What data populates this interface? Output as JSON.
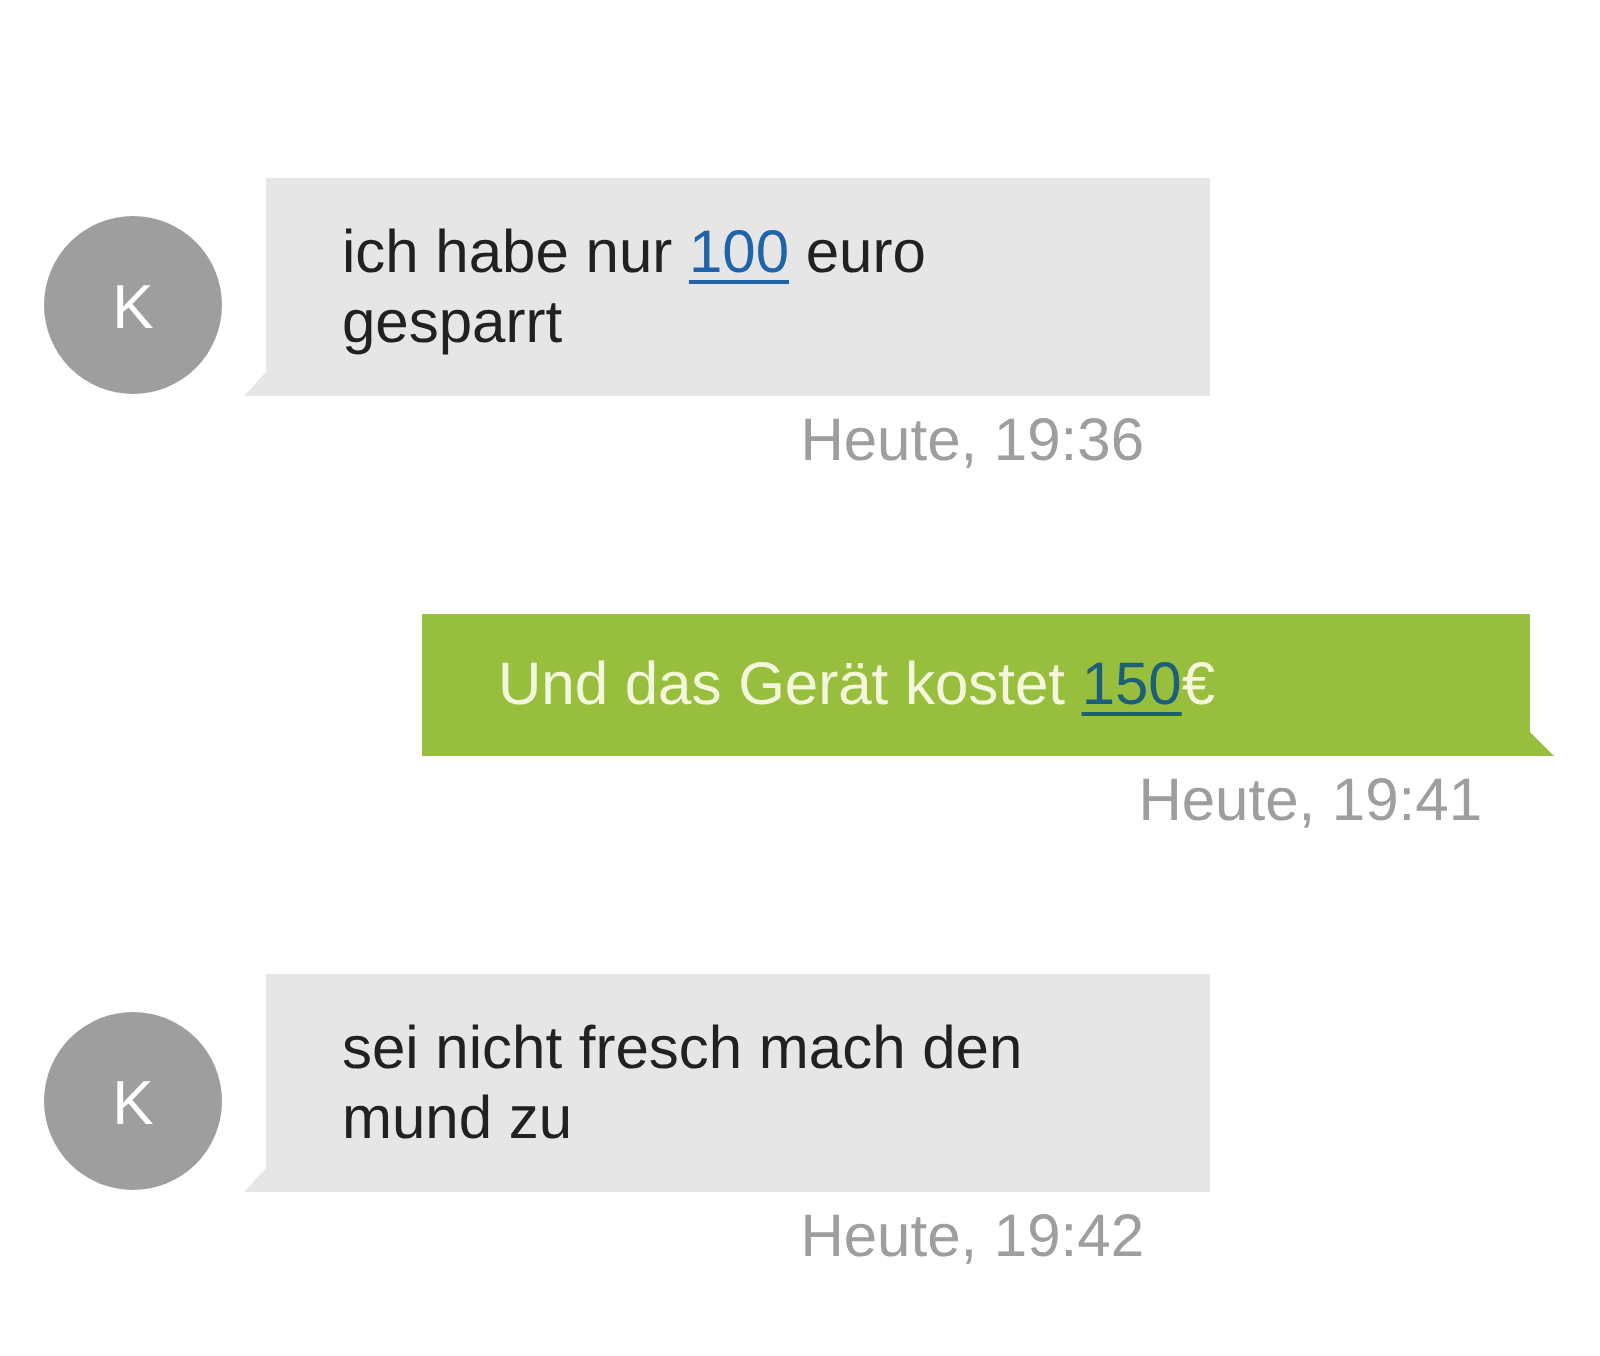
{
  "messages": [
    {
      "kind": "incoming",
      "avatar": "K",
      "segments": [
        {
          "kind": "text",
          "text": "ich habe nur "
        },
        {
          "kind": "link",
          "text": "100"
        },
        {
          "kind": "text",
          "text": " euro gesparrt"
        }
      ],
      "time": "Heute, 19:36"
    },
    {
      "kind": "outgoing",
      "segments": [
        {
          "kind": "text",
          "text": "Und das Gerät kostet "
        },
        {
          "kind": "link",
          "text": "150"
        },
        {
          "kind": "text",
          "text": "€"
        }
      ],
      "time": "Heute, 19:41"
    },
    {
      "kind": "incoming",
      "avatar": "K",
      "segments": [
        {
          "kind": "text",
          "text": "sei nicht fresch mach den mund zu"
        }
      ],
      "time": "Heute, 19:42"
    }
  ]
}
